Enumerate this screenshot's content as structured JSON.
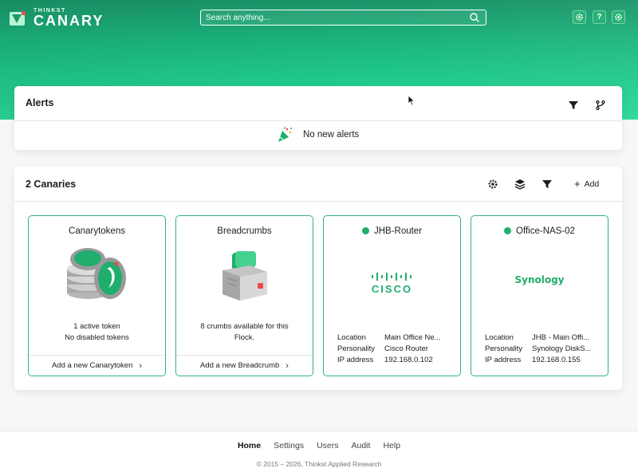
{
  "header": {
    "logo_small": "THINKST",
    "logo_big": "CANARY",
    "search_placeholder": "Search anything...",
    "buttons": [
      "settings-icon",
      "help-icon",
      "gear-icon"
    ],
    "help_label": "?"
  },
  "alerts": {
    "title": "Alerts",
    "empty_text": "No new alerts"
  },
  "canaries": {
    "title": "2 Canaries",
    "add_label": "Add",
    "tiles": [
      {
        "title": "Canarytokens",
        "line1": "1 active token",
        "line2": "No disabled tokens",
        "footer": "Add a new Canarytoken"
      },
      {
        "title": "Breadcrumbs",
        "line1": "8 crumbs available for this",
        "line2": "Flock.",
        "footer": "Add a new Breadcrumb"
      },
      {
        "title": "JHB-Router",
        "status": "online",
        "logo_text": "CISCO",
        "location_label": "Location",
        "location": "Main Office Ne...",
        "personality_label": "Personality",
        "personality": "Cisco Router",
        "ip_label": "IP address",
        "ip": "192.168.0.102"
      },
      {
        "title": "Office-NAS-02",
        "status": "online",
        "logo_text": "Synology",
        "location_label": "Location",
        "location": "JHB - Main Offi...",
        "personality_label": "Personality",
        "personality": "Synology DiskS...",
        "ip_label": "IP address",
        "ip": "192.168.0.155"
      }
    ]
  },
  "footer": {
    "nav": [
      "Home",
      "Settings",
      "Users",
      "Audit",
      "Help"
    ],
    "active": "Home",
    "copyright": "© 2015 – 2026, Thinkst Applied Research"
  },
  "colors": {
    "accent": "#1fae6d",
    "hero": "#20c98b",
    "status_online": "#1fae6d"
  }
}
